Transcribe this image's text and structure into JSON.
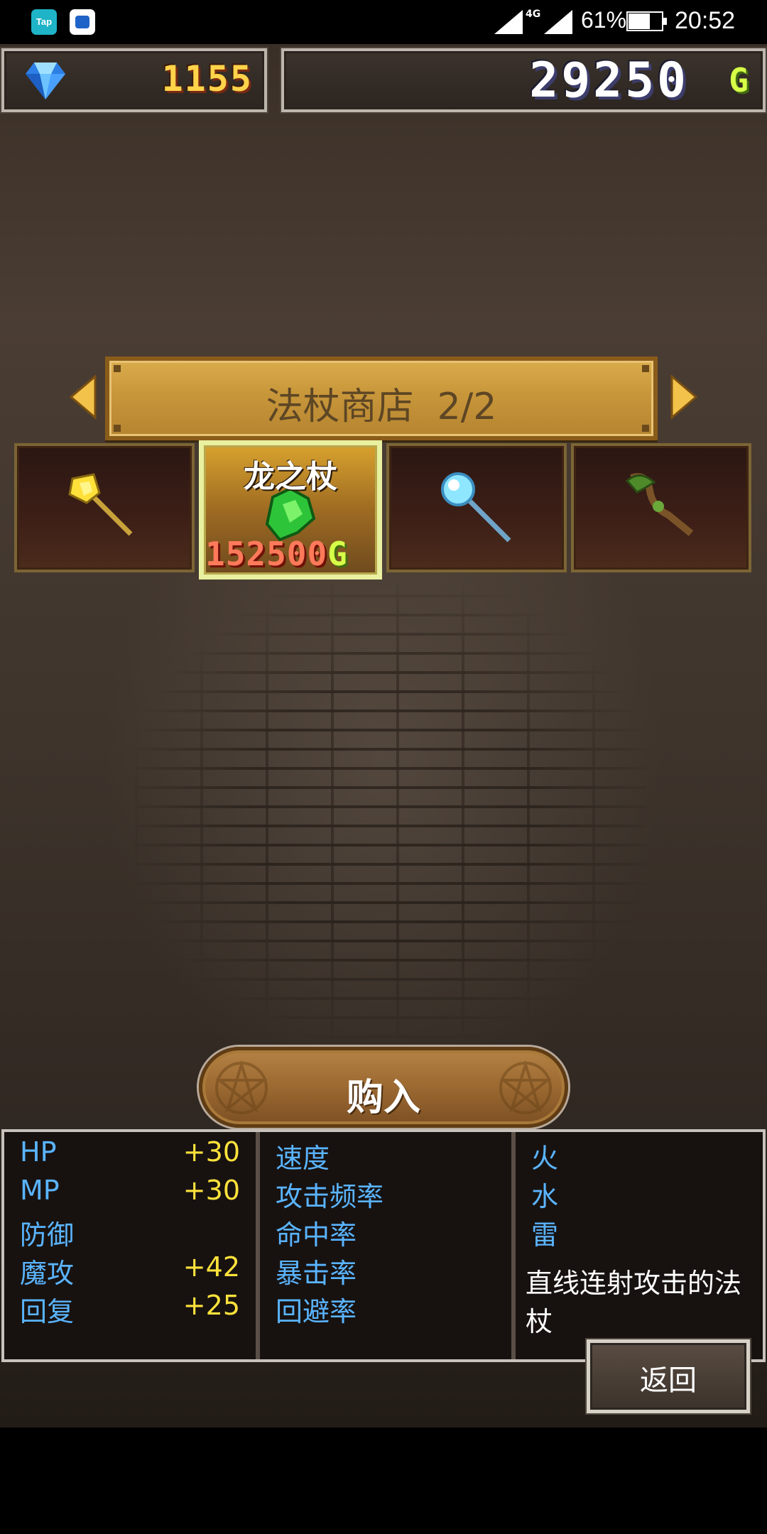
{
  "status_bar": {
    "app_icon_1": "Tap",
    "network": "4G",
    "battery": "61%",
    "time": "20:52"
  },
  "currency": {
    "gems": "1155",
    "gold": "29250",
    "gold_unit": "G"
  },
  "shop": {
    "title": "法杖商店  2/2",
    "items": [
      {
        "icon": "golden-staff-icon"
      },
      {
        "name": "龙之杖",
        "price": "152500",
        "price_unit": "G",
        "icon": "dragon-staff-icon",
        "selected": true
      },
      {
        "icon": "ice-orb-staff-icon"
      },
      {
        "icon": "vine-staff-icon"
      }
    ]
  },
  "buy_button": {
    "label": "购入"
  },
  "stats": {
    "col1": [
      {
        "label": "HP",
        "value": "+30"
      },
      {
        "label": "MP",
        "value": "+30"
      },
      {
        "label": "防御",
        "value": ""
      },
      {
        "label": "魔攻",
        "value": "+42"
      },
      {
        "label": "回复",
        "value": "+25"
      }
    ],
    "col2": [
      {
        "label": "速度"
      },
      {
        "label": "攻击频率"
      },
      {
        "label": "命中率"
      },
      {
        "label": "暴击率"
      },
      {
        "label": "回避率"
      }
    ],
    "col3": [
      {
        "label": "火"
      },
      {
        "label": "水"
      },
      {
        "label": "雷"
      }
    ],
    "description": "直线连射攻击的法杖"
  },
  "back_button": {
    "label": "返回"
  },
  "colors": {
    "stat_label": "#5ab4ff",
    "stat_value": "#ffe23c",
    "gold_unit": "#d7ff48",
    "price": "#ff7a5a"
  }
}
